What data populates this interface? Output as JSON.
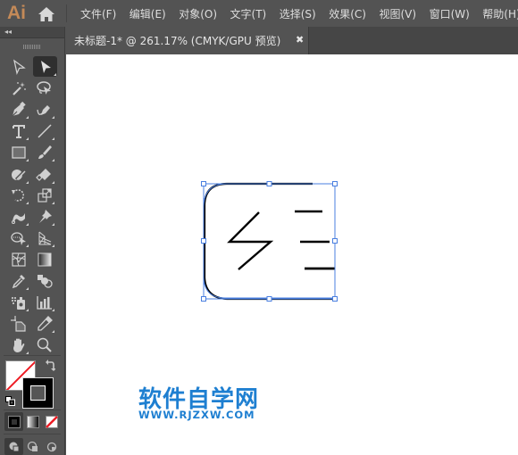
{
  "app": {
    "logo": "Ai",
    "home_icon": "home-icon"
  },
  "menu": {
    "items": [
      {
        "label": "文件(F)"
      },
      {
        "label": "编辑(E)"
      },
      {
        "label": "对象(O)"
      },
      {
        "label": "文字(T)"
      },
      {
        "label": "选择(S)"
      },
      {
        "label": "效果(C)"
      },
      {
        "label": "视图(V)"
      },
      {
        "label": "窗口(W)"
      },
      {
        "label": "帮助(H)"
      }
    ]
  },
  "tools_panel": {
    "collapse_label": "◂◂",
    "tools": [
      {
        "name": "direct-selection-tool",
        "icon": "hollow-arrow-icon"
      },
      {
        "name": "selection-tool",
        "icon": "solid-arrow-icon",
        "active": true
      },
      {
        "name": "magic-wand-tool",
        "icon": "magic-wand-icon"
      },
      {
        "name": "lasso-tool",
        "icon": "lasso-icon"
      },
      {
        "name": "pen-tool",
        "icon": "pen-icon"
      },
      {
        "name": "curvature-tool",
        "icon": "curvature-pen-icon"
      },
      {
        "name": "type-tool",
        "icon": "type-icon"
      },
      {
        "name": "line-segment-tool",
        "icon": "line-icon"
      },
      {
        "name": "rectangle-tool",
        "icon": "rectangle-icon"
      },
      {
        "name": "paintbrush-tool",
        "icon": "brush-icon"
      },
      {
        "name": "shaper-tool",
        "icon": "shaper-icon"
      },
      {
        "name": "eraser-tool",
        "icon": "eraser-icon"
      },
      {
        "name": "rotate-tool",
        "icon": "rotate-icon"
      },
      {
        "name": "scale-tool",
        "icon": "scale-icon"
      },
      {
        "name": "warp-tool",
        "icon": "warp-icon"
      },
      {
        "name": "puppet-warp-tool",
        "icon": "pin-icon"
      },
      {
        "name": "shape-builder-tool",
        "icon": "shape-builder-icon"
      },
      {
        "name": "perspective-grid-tool",
        "icon": "perspective-grid-icon"
      },
      {
        "name": "mesh-tool",
        "icon": "mesh-icon"
      },
      {
        "name": "gradient-tool",
        "icon": "gradient-icon"
      },
      {
        "name": "eyedropper-tool",
        "icon": "eyedropper-icon"
      },
      {
        "name": "blend-tool",
        "icon": "blend-icon"
      },
      {
        "name": "symbol-sprayer-tool",
        "icon": "symbol-sprayer-icon"
      },
      {
        "name": "column-graph-tool",
        "icon": "bar-graph-icon"
      },
      {
        "name": "artboard-tool",
        "icon": "artboard-icon"
      },
      {
        "name": "slice-tool",
        "icon": "slice-icon"
      },
      {
        "name": "hand-tool",
        "icon": "hand-icon"
      },
      {
        "name": "zoom-tool",
        "icon": "magnifier-icon"
      }
    ],
    "fill": {
      "color": "none",
      "swatch_bg": "#ffffff",
      "slash": "#ee1c24"
    },
    "stroke": {
      "color": "#000000"
    },
    "swap_icon": "⤵",
    "color_modes": [
      "color",
      "gradient",
      "none"
    ],
    "draw_modes": [
      "draw-normal",
      "draw-behind",
      "draw-inside"
    ]
  },
  "document": {
    "tab_title": "未标题-1* @ 261.17% (CMYK/GPU 预览)",
    "close_glyph": "✖",
    "zoom_level": "261.17%",
    "color_mode": "CMYK/GPU 预览"
  },
  "artwork": {
    "stroke_color": "#000000",
    "selection_color": "#4a7fe0"
  },
  "watermark": {
    "title": "软件自学网",
    "url": "WWW.RJZXW.COM",
    "color": "#1e7fd1"
  }
}
